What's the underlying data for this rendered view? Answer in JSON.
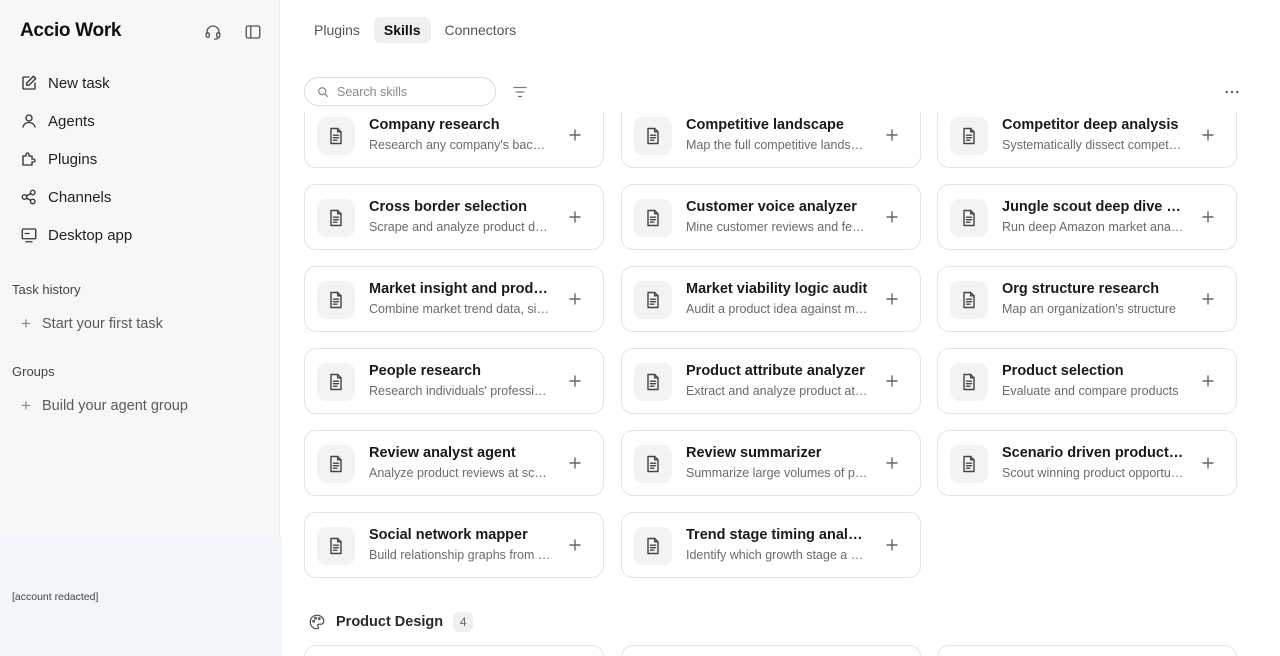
{
  "sidebar": {
    "brand": "Accio Work",
    "support_icon": "headset-icon",
    "toggle_icon": "sidebar-toggle-icon",
    "nav": [
      {
        "label": "New task",
        "icon": "edit-icon"
      },
      {
        "label": "Agents",
        "icon": "user-icon"
      },
      {
        "label": "Plugins",
        "icon": "plugin-icon"
      },
      {
        "label": "Channels",
        "icon": "channels-icon"
      },
      {
        "label": "Desktop app",
        "icon": "monitor-icon"
      }
    ],
    "task_history": {
      "label": "Task history",
      "action": "Start your first task"
    },
    "groups": {
      "label": "Groups",
      "action": "Build your agent group"
    },
    "account": "[account redacted]"
  },
  "tabs": [
    {
      "label": "Plugins",
      "active": false
    },
    {
      "label": "Skills",
      "active": true
    },
    {
      "label": "Connectors",
      "active": false
    }
  ],
  "search": {
    "placeholder": "Search skills",
    "value": ""
  },
  "skills": [
    {
      "title": "Company research",
      "desc": "Research any company's background and more"
    },
    {
      "title": "Competitive landscape",
      "desc": "Map the full competitive landscape of a market"
    },
    {
      "title": "Competitor deep analysis",
      "desc": "Systematically dissect competitors"
    },
    {
      "title": "Cross border selection",
      "desc": "Scrape and analyze product data"
    },
    {
      "title": "Customer voice analyzer",
      "desc": "Mine customer reviews and feedback"
    },
    {
      "title": "Jungle scout deep dive analysis",
      "desc": "Run deep Amazon market analysis"
    },
    {
      "title": "Market insight and product planning",
      "desc": "Combine market trend data, signals"
    },
    {
      "title": "Market viability logic audit",
      "desc": "Audit a product idea against market logic"
    },
    {
      "title": "Org structure research",
      "desc": "Map an organization's structure"
    },
    {
      "title": "People research",
      "desc": "Research individuals' professional background"
    },
    {
      "title": "Product attribute analyzer",
      "desc": "Extract and analyze product attributes"
    },
    {
      "title": "Product selection",
      "desc": "Evaluate and compare products"
    },
    {
      "title": "Review analyst agent",
      "desc": "Analyze product reviews at scale"
    },
    {
      "title": "Review summarizer",
      "desc": "Summarize large volumes of product reviews"
    },
    {
      "title": "Scenario driven product discovery",
      "desc": "Scout winning product opportunities"
    },
    {
      "title": "Social network mapper",
      "desc": "Build relationship graphs from data"
    },
    {
      "title": "Trend stage timing analyzer",
      "desc": "Identify which growth stage a market is in"
    }
  ],
  "next_group": {
    "title": "Product Design",
    "count": "4",
    "icon": "palette-icon"
  },
  "colors": {
    "sidebar_bg": "#f7f7f7",
    "card_border": "#e4e4e4",
    "active_tab_bg": "#f0f0f0"
  }
}
